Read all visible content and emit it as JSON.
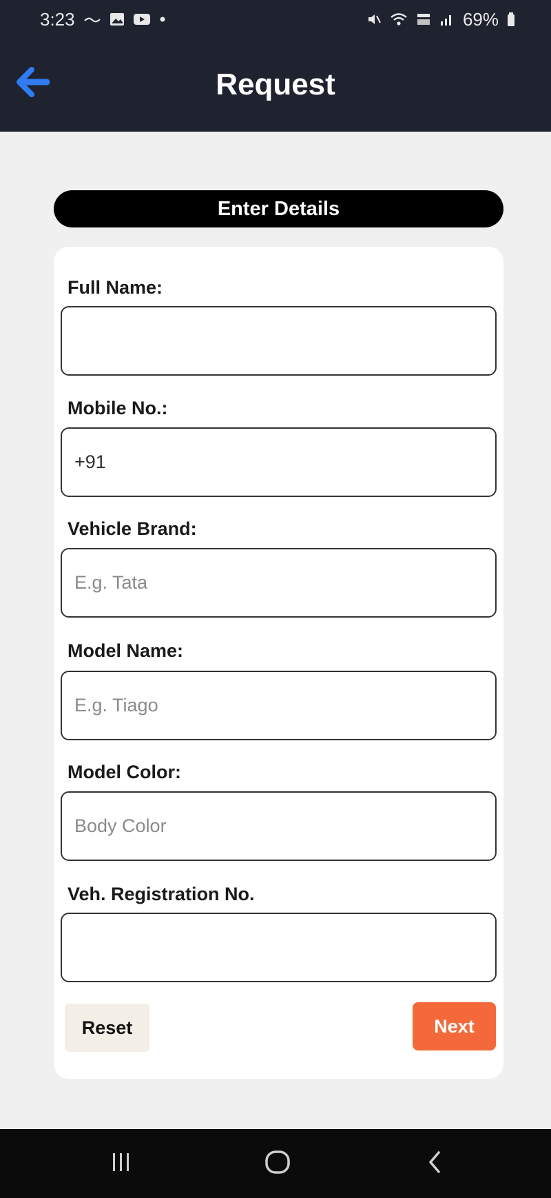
{
  "status_bar": {
    "time": "3:23",
    "battery": "69%",
    "icons": [
      "missed-call-icon",
      "gallery-icon",
      "youtube-icon",
      "dot-icon",
      "mute-icon",
      "wifi-icon",
      "volte-icon",
      "signal-icon",
      "battery-icon"
    ]
  },
  "header": {
    "title": "Request",
    "back_icon": "arrow-left-icon",
    "accent_color": "#2f7df0",
    "background_color": "#1f2330"
  },
  "section": {
    "title": "Enter Details"
  },
  "form": {
    "fields": [
      {
        "label": "Full Name:",
        "value": "",
        "placeholder": ""
      },
      {
        "label": "Mobile No.:",
        "value": "+91",
        "placeholder": ""
      },
      {
        "label": "Vehicle Brand:",
        "value": "",
        "placeholder": "E.g. Tata"
      },
      {
        "label": "Model Name:",
        "value": "",
        "placeholder": "E.g. Tiago"
      },
      {
        "label": "Model Color:",
        "value": "",
        "placeholder": "Body Color"
      },
      {
        "label": "Veh. Registration No.",
        "value": "",
        "placeholder": ""
      }
    ],
    "reset_label": "Reset",
    "next_label": "Next",
    "next_color": "#f4693a"
  },
  "nav_bar": {
    "icons": [
      "recents-icon",
      "home-icon",
      "back-icon"
    ]
  }
}
